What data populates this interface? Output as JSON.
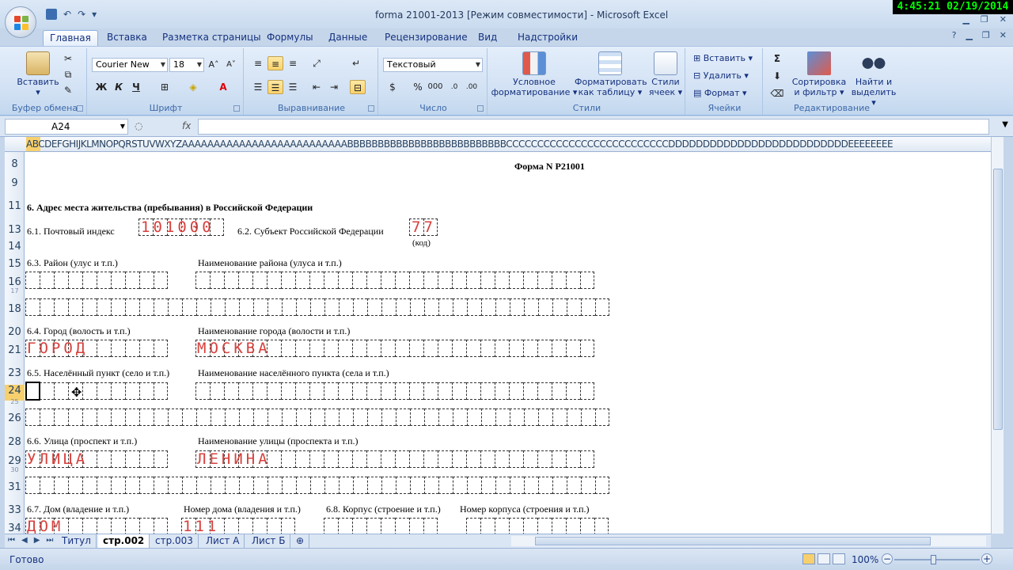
{
  "window": {
    "title": "forma 21001-2013  [Режим совместимости] - Microsoft Excel",
    "clock": "4:45:21  02/19/2014"
  },
  "ribbon_tabs": [
    "Главная",
    "Вставка",
    "Разметка страницы",
    "Формулы",
    "Данные",
    "Рецензирование",
    "Вид",
    "Надстройки"
  ],
  "clipboard": {
    "paste_label": "Вставить",
    "group": "Буфер обмена"
  },
  "font": {
    "name": "Courier New",
    "size": "18",
    "bold": "Ж",
    "italic": "К",
    "underline": "Ч",
    "group": "Шрифт"
  },
  "alignment": {
    "group": "Выравнивание"
  },
  "number": {
    "format": "Текстовый",
    "percent": "%",
    "thousands": "000",
    "group": "Число"
  },
  "styles": {
    "conditional": "Условное форматирование",
    "as_table": "Форматировать как таблицу",
    "cell_styles": "Стили ячеек",
    "group": "Стили"
  },
  "cells": {
    "insert": "Вставить",
    "delete": "Удалить",
    "format": "Формат",
    "group": "Ячейки"
  },
  "editing": {
    "sigma": "Σ",
    "sort": "Сортировка и фильтр",
    "find": "Найти и выделить",
    "group": "Редактирование"
  },
  "formula_bar": {
    "name_box": "A24",
    "fx": "fx",
    "content": ""
  },
  "column_header_text": "ABCDEFGHIJKLMNOPQRSTUVWXYZAAAAAAAAAAAAAAAAAAAAAAAAAABBBBBBBBBBBBBBBBBBBBBBBBBBCCCCCCCCCCCCCCCCCCCCCCCCCCDDDDDDDDDDDDDDDDDDDDDDDDDDEEEEEEEE",
  "rows": [
    "8",
    "9",
    "11",
    "13",
    "14",
    "15",
    "16",
    "17",
    "18",
    "20",
    "21",
    "23",
    "24",
    "25",
    "26",
    "28",
    "29",
    "30",
    "31",
    "33",
    "34"
  ],
  "form": {
    "title": "Форма N Р21001",
    "section": "6. Адрес места жительства (пребывания) в Российской Федерации",
    "postal_label": "6.1. Почтовый индекс",
    "postal_value": "101000",
    "subject_label": "6.2. Субъект Российской Федерации",
    "subject_value": "77",
    "code_note": "(код)",
    "district_label": "6.3. Район (улус и т.п.)",
    "district_name_label": "Наименование района (улуса и т.п.)",
    "city_label": "6.4. Город (волость и т.п.)",
    "city_value": "ГОРОД",
    "city_name_label": "Наименование города (волости и т.п.)",
    "city_name_value": "МОСКВА",
    "locality_label": "6.5. Населённый пункт (село и т.п.)",
    "locality_name_label": "Наименование населённого пункта (села и т.п.)",
    "street_label": "6.6. Улица (проспект и т.п.)",
    "street_value": "УЛИЦА",
    "street_name_label": "Наименование улицы (проспекта и т.п.)",
    "street_name_value": "ЛЕНИНА",
    "house_label": "6.7. Дом (владение и т.п.)",
    "house_value": "ДОМ",
    "house_number_label": "Номер дома (владения и т.п.)",
    "house_number_value": "111",
    "building_label": "6.8. Корпус (строение и т.п.)",
    "building_number_label": "Номер корпуса (строения и т.п.)"
  },
  "sheet_tabs": [
    "Титул",
    "стр.002",
    "стр.003",
    "Лист А",
    "Лист Б"
  ],
  "status": {
    "ready": "Готово",
    "zoom": "100%"
  }
}
